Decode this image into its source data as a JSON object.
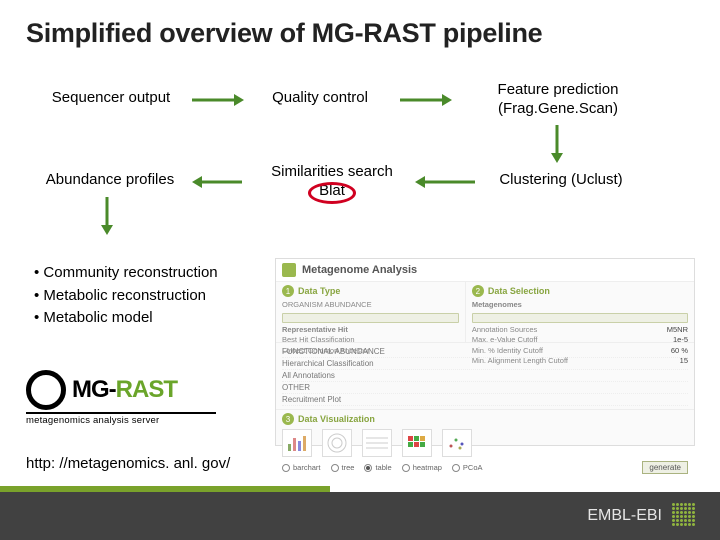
{
  "title": "Simplified overview of MG-RAST pipeline",
  "flow": {
    "n1": "Sequencer output",
    "n2": "Quality control",
    "n3a": "Feature prediction",
    "n3b": "(Frag.Gene.Scan)",
    "n4": "Abundance profiles",
    "n5a": "Similarities search",
    "n5b": "Blat",
    "n6": "Clustering (Uclust)"
  },
  "bullets": {
    "b1": "Community reconstruction",
    "b2": "Metabolic reconstruction",
    "b3": "Metabolic model"
  },
  "logo": {
    "prefix": "MG-",
    "suffix": "RAST",
    "sub": "metagenomics analysis server"
  },
  "url": "http: //metagenomics. anl. gov/",
  "screenshot": {
    "title": "Metagenome Analysis",
    "pane1": {
      "num": "1",
      "title": "Data Type",
      "l1": "ORGANISM ABUNDANCE",
      "l2": "Representative Hit",
      "l3": "Best Hit Classification",
      "l4": "Lowest Common Ancestor"
    },
    "pane2": {
      "num": "2",
      "title": "Data Selection",
      "h": "Metagenomes",
      "r1k": "Annotation Sources",
      "r1v": "M5NR",
      "r2k": "Max. e-Value Cutoff",
      "r2v": "1e-5",
      "r3k": "Min. % Identity Cutoff",
      "r3v": "60 %",
      "r4k": "Min. Alignment Length Cutoff",
      "r4v": "15"
    },
    "mid": {
      "r1": "FUNCTIONAL ABUNDANCE",
      "r2": "Hierarchical Classification",
      "r3": "All Annotations",
      "r4": "OTHER",
      "r5": "Recruitment Plot"
    },
    "viz": {
      "num": "3",
      "title": "Data Visualization",
      "o1": "barchart",
      "o2": "tree",
      "o3": "table",
      "o4": "heatmap",
      "o5": "PCoA",
      "gen": "generate"
    }
  },
  "footer": {
    "brand": "EMBL-EBI"
  }
}
